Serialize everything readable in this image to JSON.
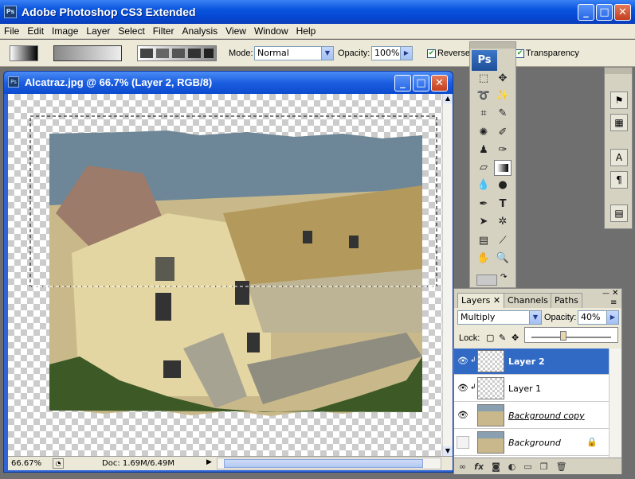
{
  "app": {
    "title": "Adobe Photoshop CS3 Extended",
    "ps_badge": "Ps"
  },
  "window_buttons": {
    "minimize": "_",
    "maximize": "□",
    "close": "✕"
  },
  "menu": [
    "File",
    "Edit",
    "Image",
    "Layer",
    "Select",
    "Filter",
    "Analysis",
    "View",
    "Window",
    "Help"
  ],
  "options": {
    "mode_label": "Mode:",
    "mode_value": "Normal",
    "opacity_label": "Opacity:",
    "opacity_value": "100%",
    "reverse_label": "Reverse",
    "transparency_label": "Transparency",
    "reverse_checked": true,
    "transparency_checked": true
  },
  "document": {
    "title": "Alcatraz.jpg @ 66.7% (Layer 2, RGB/8)",
    "zoom": "66.67%",
    "doc_info": "Doc: 1.69M/6.49M"
  },
  "toolbox": {
    "ps_badge": "Ps"
  },
  "layers_panel": {
    "tabs": [
      "Layers",
      "Channels",
      "Paths"
    ],
    "blend_mode": "Multiply",
    "opacity_label": "Opacity:",
    "opacity_value": "40%",
    "opacity_fraction": 0.4,
    "lock_label": "Lock:",
    "layers": [
      {
        "name": "Layer 2",
        "selected": true,
        "visible": true,
        "linked": true
      },
      {
        "name": "Layer 1",
        "selected": false,
        "visible": true,
        "linked": true
      },
      {
        "name": "Background copy",
        "selected": false,
        "visible": true,
        "linked": false
      },
      {
        "name": "Background",
        "selected": false,
        "visible": false,
        "linked": false,
        "locked": true
      }
    ],
    "footer_icons": [
      "link-icon",
      "fx-icon",
      "mask-icon",
      "adjustment-icon",
      "folder-icon",
      "new-layer-icon",
      "trash-icon"
    ]
  },
  "colors": {
    "xp_blue": "#0a55de",
    "selection_blue": "#316ac5",
    "panel_gray": "#ece9d8",
    "workspace": "#6f6f6f"
  }
}
